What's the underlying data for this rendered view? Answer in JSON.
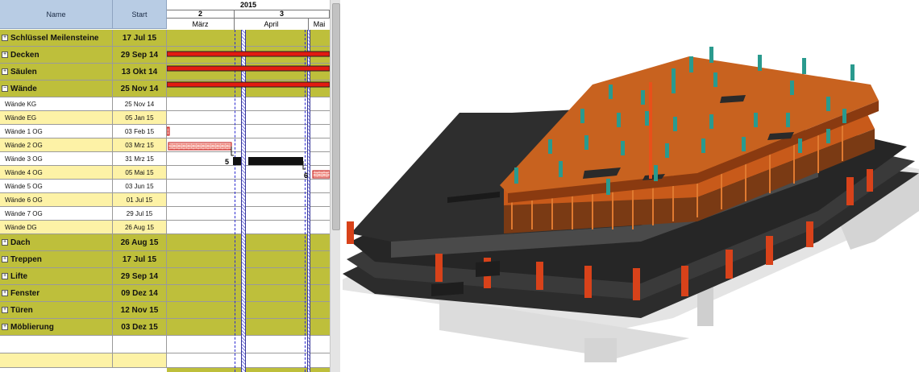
{
  "gantt": {
    "columns": {
      "name": "Name",
      "start": "Start"
    },
    "timeline": {
      "year": "2015",
      "quarters": [
        "2",
        "3"
      ],
      "months": [
        "März",
        "April",
        "Mai"
      ]
    },
    "rows": [
      {
        "name": "Schlüssel Meilensteine",
        "start": "17 Jul 15",
        "kind": "summary",
        "expander": "plus"
      },
      {
        "name": "Decken",
        "start": "29 Sep 14",
        "kind": "summary",
        "expander": "plus"
      },
      {
        "name": "Säulen",
        "start": "13 Okt 14",
        "kind": "summary",
        "expander": "plus"
      },
      {
        "name": "Wände",
        "start": "25 Nov 14",
        "kind": "summary",
        "expander": "minus"
      },
      {
        "name": "Wände KG",
        "start": "25 Nov 14",
        "kind": "task"
      },
      {
        "name": "Wände EG",
        "start": "05 Jan 15",
        "kind": "task"
      },
      {
        "name": "Wände 1 OG",
        "start": "03 Feb 15",
        "kind": "task"
      },
      {
        "name": "Wände 2 OG",
        "start": "03 Mrz 15",
        "kind": "task"
      },
      {
        "name": "Wände 3 OG",
        "start": "31 Mrz 15",
        "kind": "task"
      },
      {
        "name": "Wände 4 OG",
        "start": "05 Mai 15",
        "kind": "task"
      },
      {
        "name": "Wände 5 OG",
        "start": "03 Jun 15",
        "kind": "task"
      },
      {
        "name": "Wände 6 OG",
        "start": "01 Jul 15",
        "kind": "task"
      },
      {
        "name": "Wände 7 OG",
        "start": "29 Jul 15",
        "kind": "task"
      },
      {
        "name": "Wände DG",
        "start": "26 Aug 15",
        "kind": "task"
      },
      {
        "name": "Dach",
        "start": "26 Aug 15",
        "kind": "summary",
        "expander": "plus"
      },
      {
        "name": "Treppen",
        "start": "17 Jul 15",
        "kind": "summary",
        "expander": "plus"
      },
      {
        "name": "Lifte",
        "start": "29 Sep 14",
        "kind": "summary",
        "expander": "plus"
      },
      {
        "name": "Fenster",
        "start": "09 Dez 14",
        "kind": "summary",
        "expander": "plus"
      },
      {
        "name": "Türen",
        "start": "12 Nov 15",
        "kind": "summary",
        "expander": "plus"
      },
      {
        "name": "Möblierung",
        "start": "03 Dez 15",
        "kind": "summary",
        "expander": "plus"
      }
    ],
    "links": [
      "5",
      "6"
    ],
    "colors": {
      "summary_row": "#bebf3b",
      "task_row_alt": "#fdf2a6",
      "summary_bar": "#e21b10",
      "task_bar": "#111111",
      "critical_bar": "#e21b10"
    }
  },
  "model": {
    "icon": "building-bim-3d-icon",
    "colors": {
      "slab": "#c8621f",
      "columns": "#2a9a8e",
      "walls": "#d8421a",
      "floors": "#2a2a2a",
      "concrete": "#d9d9d9"
    }
  }
}
